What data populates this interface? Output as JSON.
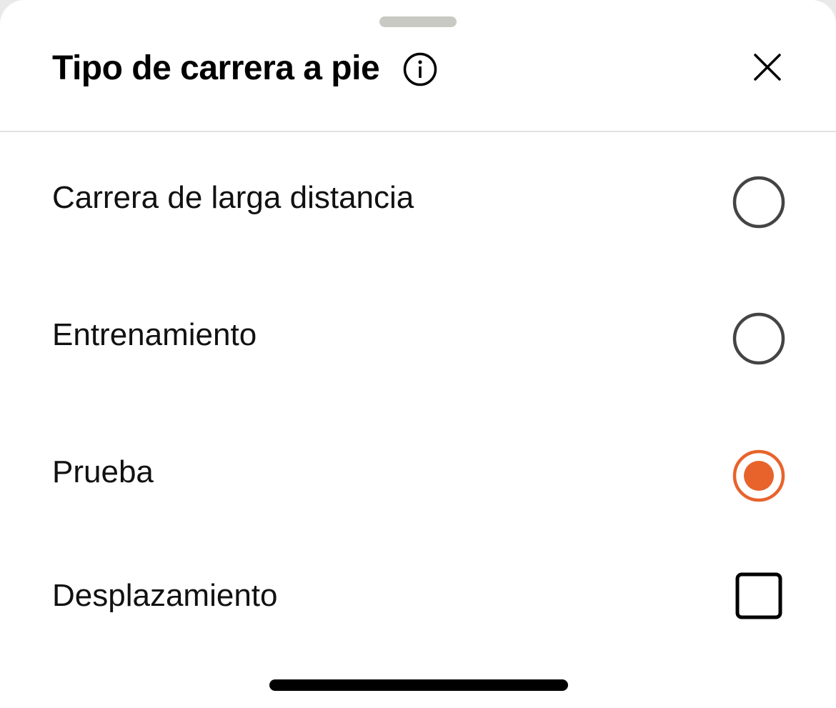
{
  "header": {
    "title": "Tipo de carrera a pie"
  },
  "options": [
    {
      "label": "Carrera de larga distancia",
      "control": "radio",
      "selected": false
    },
    {
      "label": "Entrenamiento",
      "control": "radio",
      "selected": false
    },
    {
      "label": "Prueba",
      "control": "radio",
      "selected": true
    },
    {
      "label": "Desplazamiento",
      "control": "checkbox",
      "selected": false
    }
  ],
  "colors": {
    "accent": "#e8632c",
    "radio_border": "#444444",
    "text": "#111111"
  },
  "icons": {
    "info": "info-circle-icon",
    "close": "close-icon"
  }
}
